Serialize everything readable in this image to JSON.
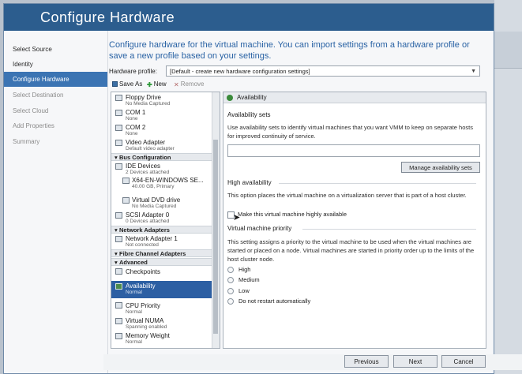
{
  "window": {
    "title": "Configure Hardware"
  },
  "sidebar": {
    "items": [
      {
        "label": "Select Source",
        "state": "normal"
      },
      {
        "label": "Identity",
        "state": "normal"
      },
      {
        "label": "Configure Hardware",
        "state": "active"
      },
      {
        "label": "Select Destination",
        "state": "disabled"
      },
      {
        "label": "Select Cloud",
        "state": "disabled"
      },
      {
        "label": "Add Properties",
        "state": "disabled"
      },
      {
        "label": "Summary",
        "state": "disabled"
      }
    ]
  },
  "main": {
    "heading": "Configure hardware for the virtual machine. You can import settings from a hardware profile or save a new profile based on your settings.",
    "hardware_profile": {
      "label": "Hardware profile:",
      "value": "[Default - create new hardware configuration settings]"
    },
    "toolbar": {
      "save_as": "Save As",
      "new": "New",
      "remove": "Remove"
    },
    "hardware_list": {
      "items": [
        {
          "name": "Floppy Drive",
          "sub": "No Media Captured"
        },
        {
          "name": "COM 1",
          "sub": "None"
        },
        {
          "name": "COM 2",
          "sub": "None"
        },
        {
          "name": "Video Adapter",
          "sub": "Default video adapter"
        },
        {
          "section": "Bus Configuration"
        },
        {
          "name": "IDE Devices",
          "sub": "2 Devices attached"
        },
        {
          "name": "X64-EN-WINDOWS SE...",
          "sub": "40.00 GB, Primary"
        },
        {
          "name": "Virtual DVD drive",
          "sub": "No Media Captured"
        },
        {
          "name": "SCSI Adapter 0",
          "sub": "0 Devices attached"
        },
        {
          "section": "Network Adapters"
        },
        {
          "name": "Network Adapter 1",
          "sub": "Not connected"
        },
        {
          "section": "Fibre Channel Adapters"
        },
        {
          "section": "Advanced"
        },
        {
          "name": "Checkpoints",
          "sub": ""
        },
        {
          "name": "Availability",
          "sub": "Normal",
          "selected": true
        },
        {
          "name": "CPU Priority",
          "sub": "Normal"
        },
        {
          "name": "Virtual NUMA",
          "sub": "Spanning enabled"
        },
        {
          "name": "Memory Weight",
          "sub": "Normal"
        }
      ]
    },
    "panel": {
      "header": "Availability",
      "availability_sets": {
        "label": "Availability sets",
        "text": "Use availability sets to identify virtual machines that you want VMM to keep on separate hosts for improved continuity of service.",
        "input_value": "",
        "manage_button": "Manage availability sets"
      },
      "high_availability": {
        "label": "High availability",
        "text": "This option places the virtual machine on a virtualization server that is part of a host cluster.",
        "checkbox_label": "Make this virtual machine highly available",
        "checked": false
      },
      "priority": {
        "label": "Virtual machine priority",
        "text": "This setting assigns a priority to the virtual machine to be used when the virtual machines are started or placed on a node. Virtual machines are started in priority order up to the limits of the host cluster node.",
        "options": [
          "High",
          "Medium",
          "Low",
          "Do not restart automatically"
        ]
      }
    }
  },
  "footer": {
    "previous": "Previous",
    "next": "Next",
    "cancel": "Cancel"
  }
}
